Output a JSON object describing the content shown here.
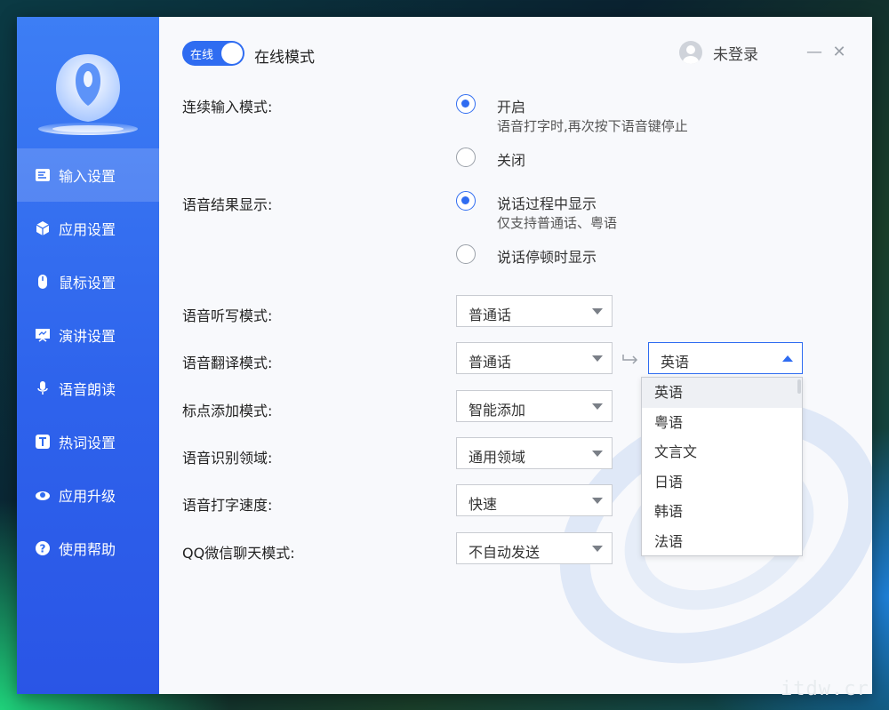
{
  "header": {
    "toggle_label": "在线",
    "mode_label": "在线模式",
    "user_name": "未登录",
    "minimize_label": "—",
    "close_label": "✕"
  },
  "sidebar": {
    "items": [
      {
        "label": "输入设置",
        "icon": "input-settings-icon",
        "active": true
      },
      {
        "label": "应用设置",
        "icon": "cube-icon"
      },
      {
        "label": "鼠标设置",
        "icon": "mouse-icon"
      },
      {
        "label": "演讲设置",
        "icon": "presentation-icon"
      },
      {
        "label": "语音朗读",
        "icon": "microphone-icon"
      },
      {
        "label": "热词设置",
        "icon": "text-t-icon"
      },
      {
        "label": "应用升级",
        "icon": "upgrade-icon"
      },
      {
        "label": "使用帮助",
        "icon": "help-icon"
      }
    ]
  },
  "settings": {
    "continuous": {
      "label": "连续输入模式:",
      "options": [
        {
          "title": "开启",
          "sub": "语音打字时,再次按下语音键停止",
          "checked": true
        },
        {
          "title": "关闭",
          "checked": false
        }
      ]
    },
    "result_display": {
      "label": "语音结果显示:",
      "options": [
        {
          "title": "说话过程中显示",
          "sub": "仅支持普通话、粤语",
          "checked": true
        },
        {
          "title": "说话停顿时显示",
          "checked": false
        }
      ]
    },
    "dictation": {
      "label": "语音听写模式:",
      "value": "普通话"
    },
    "translation": {
      "label": "语音翻译模式:",
      "value": "普通话",
      "target_value": "英语",
      "target_options": [
        "英语",
        "粤语",
        "文言文",
        "日语",
        "韩语",
        "法语"
      ]
    },
    "punctuation": {
      "label": "标点添加模式:",
      "value": "智能添加"
    },
    "domain": {
      "label": "语音识别领域:",
      "value": "通用领域"
    },
    "speed": {
      "label": "语音打字速度:",
      "value": "快速"
    },
    "chat": {
      "label": "QQ微信聊天模式:",
      "value": "不自动发送"
    }
  },
  "watermark_text": "itdw.cr",
  "colors": {
    "accent": "#2f6cf1",
    "sidebar_top": "#3d7ef5",
    "sidebar_bottom": "#2a55e6"
  }
}
